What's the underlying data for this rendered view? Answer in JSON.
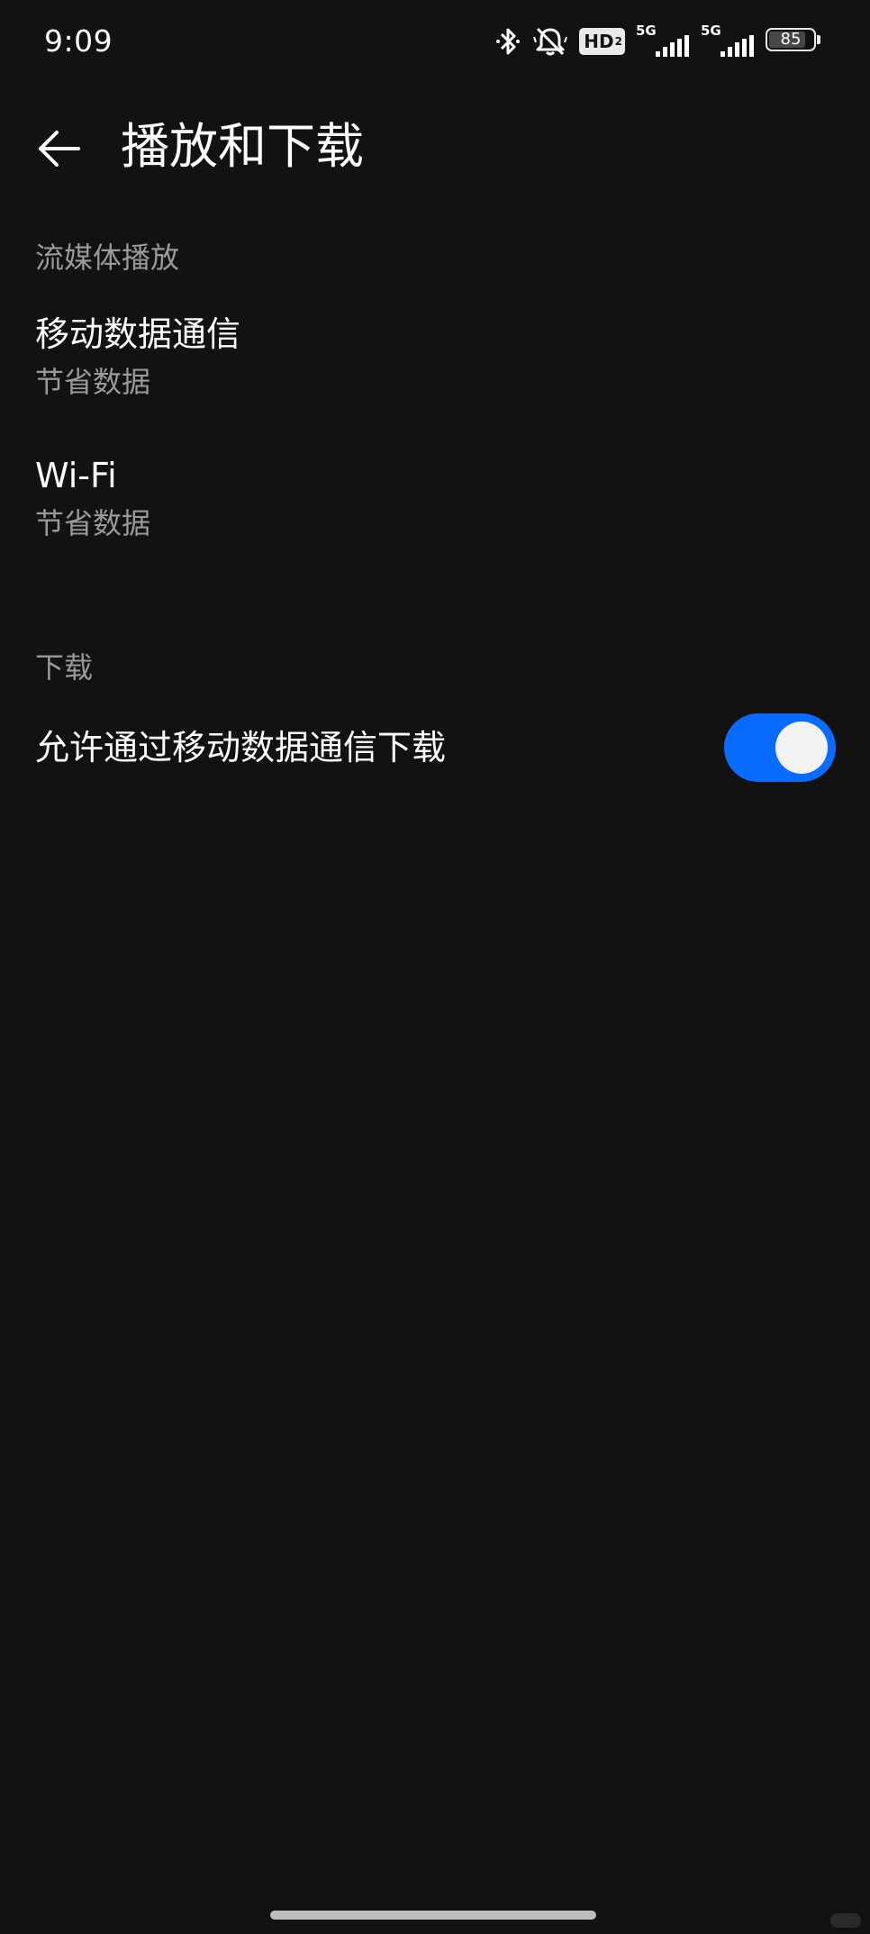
{
  "status_bar": {
    "time": "9:09",
    "hd_label": "HD",
    "hd_sub": "2",
    "sim1_label": "5G",
    "sim2_label": "5G",
    "battery_level": "85",
    "icons": [
      "bluetooth-icon",
      "bell-muted-icon",
      "hd-badge",
      "signal-icon",
      "signal-icon",
      "battery-icon"
    ]
  },
  "app_bar": {
    "back_icon": "arrow-left-icon",
    "title": "播放和下载"
  },
  "streaming": {
    "header": "流媒体播放",
    "items": [
      {
        "title": "移动数据通信",
        "summary": "节省数据"
      },
      {
        "title": "Wi-Fi",
        "summary": "节省数据"
      }
    ]
  },
  "download": {
    "header": "下载",
    "mobile_download": {
      "label": "允许通过移动数据通信下载",
      "enabled": true
    }
  },
  "colors": {
    "background": "#121212",
    "accent": "#0a6cff",
    "secondary_text": "#9a9a9a"
  }
}
